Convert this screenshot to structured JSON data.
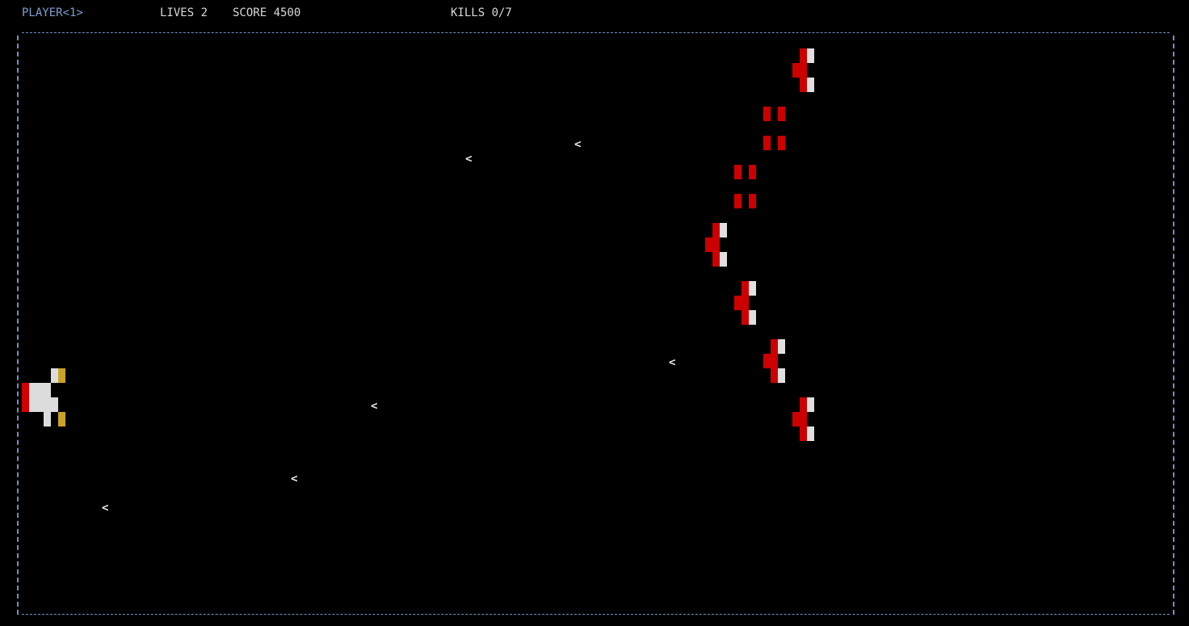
{
  "hud": {
    "player": "PLAYER<1>",
    "lives": "LIVES 2",
    "score": "SCORE 4500",
    "kills": "KILLS 0/7"
  },
  "colors": {
    "border": "#6f90c4",
    "player_label": "#7ea0cf",
    "hud_text": "#d8d8d8",
    "enemy_red": "#cc0000",
    "enemy_white": "#e0e0e0",
    "ship_white": "#dcdcdc",
    "ship_red": "#d40000",
    "ship_gold": "#c9a227",
    "bullet": "#e8e8e8"
  },
  "bullet_glyph": "<",
  "icons": {
    "player_ship": "player-ship-icon",
    "enemy_fighter": "enemy-fighter-icon",
    "enemy_pod": "enemy-pod-icon",
    "bullet": "enemy-bullet-icon"
  }
}
